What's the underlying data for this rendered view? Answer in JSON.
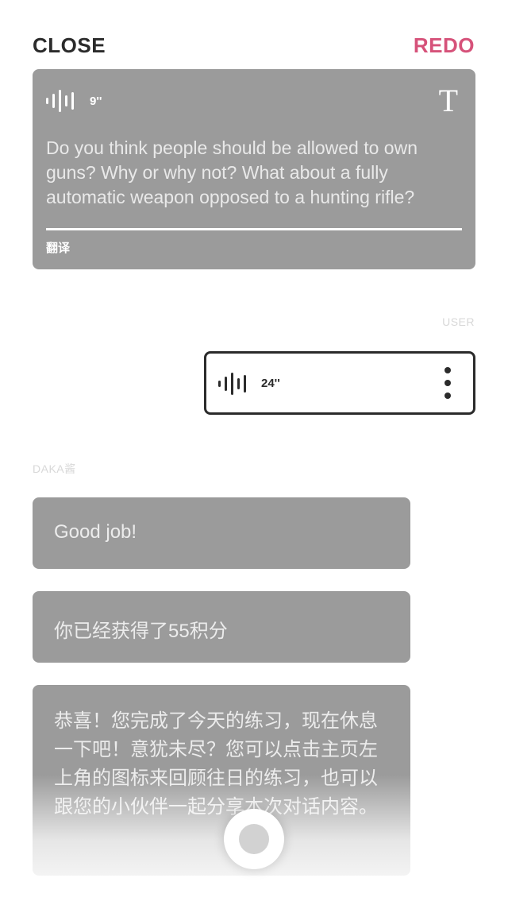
{
  "header": {
    "close_label": "CLOSE",
    "redo_label": "REDO"
  },
  "colors": {
    "accent": "#d6527a",
    "card_gray": "#9b9b9b",
    "dark": "#2b2b2b"
  },
  "prompt": {
    "duration": "9''",
    "text": "Do you think people should be allowed to own guns? Why or why not? What about a fully automatic weapon opposed to a hunting rifle?",
    "translate_label": "翻译",
    "text_icon": "T"
  },
  "user": {
    "label": "USER",
    "duration": "24''"
  },
  "bot": {
    "label": "DAKA酱",
    "messages": [
      "Good job!",
      "你已经获得了55积分",
      "恭喜！您完成了今天的练习，现在休息一下吧！意犹未尽？您可以点击主页左上角的图标来回顾往日的练习，也可以跟您的小伙伴一起分享本次对话内容。"
    ]
  }
}
